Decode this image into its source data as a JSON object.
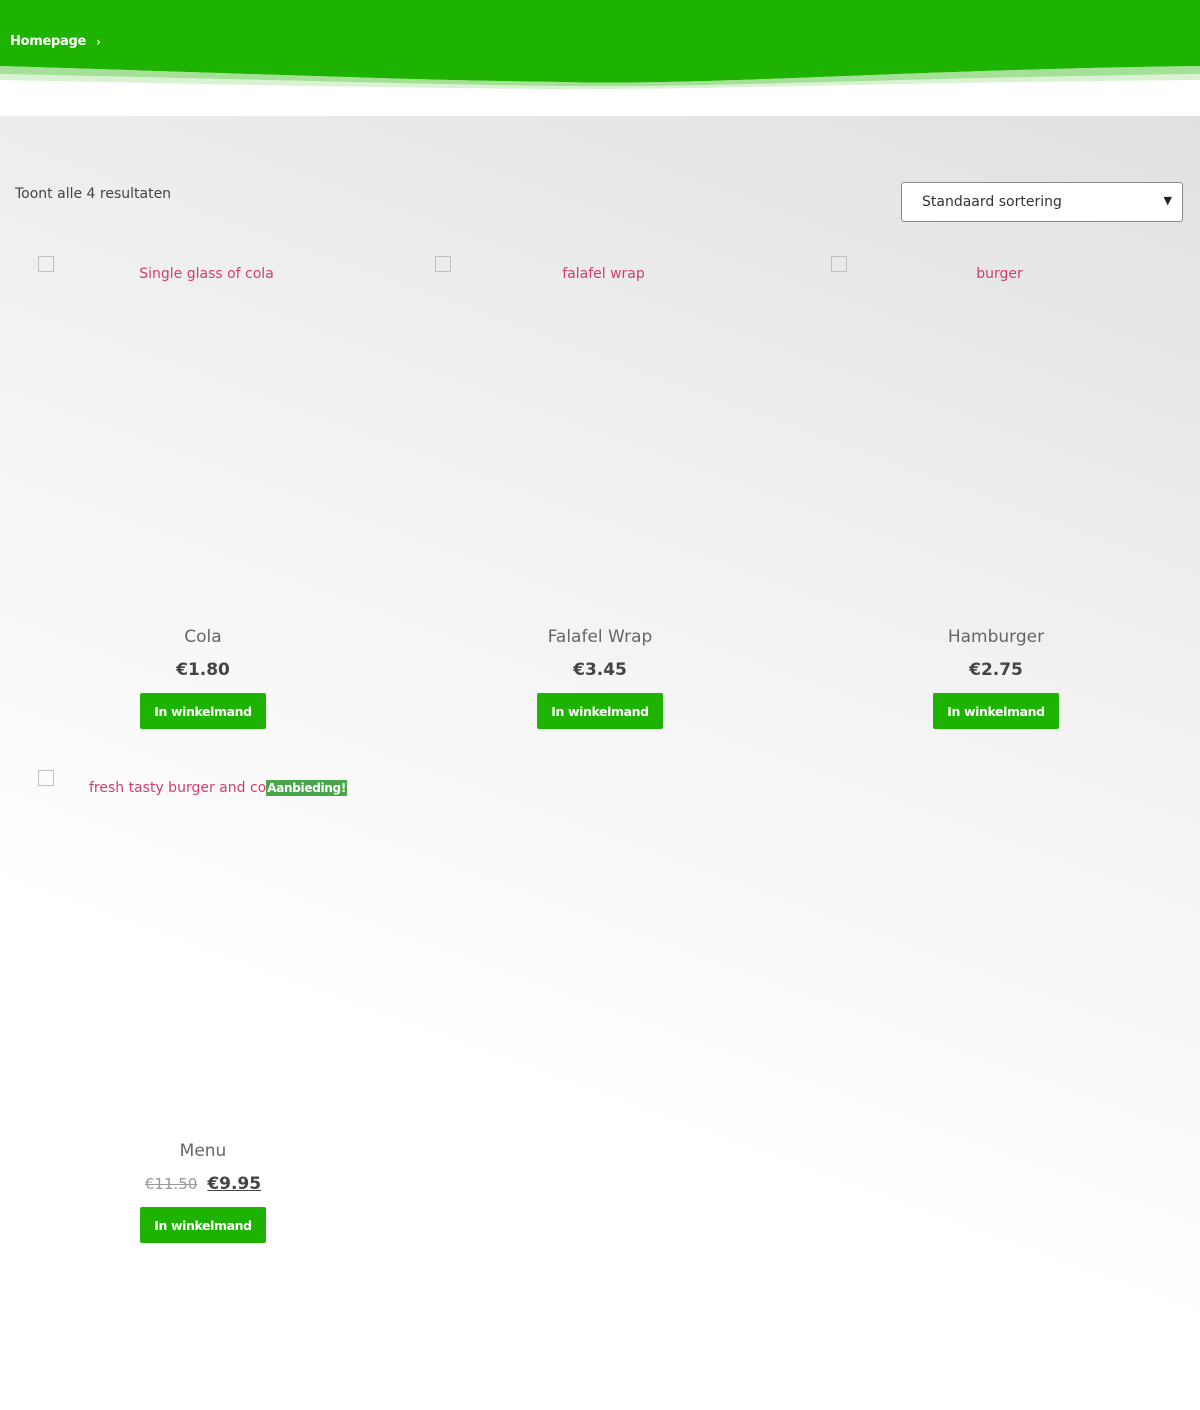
{
  "header": {
    "breadcrumb_home": "Homepage",
    "breadcrumb_separator": "›",
    "accent_color": "#1db300"
  },
  "shop": {
    "result_count": "Toont alle 4 resultaten",
    "sort_selected": "Standaard sortering"
  },
  "products": [
    {
      "image_alt": "Single glass of cola",
      "name": "Cola",
      "price": "€1.80",
      "button": "In winkelmand"
    },
    {
      "image_alt": "falafel wrap",
      "name": "Falafel Wrap",
      "price": "€3.45",
      "button": "In winkelmand"
    },
    {
      "image_alt": "burger",
      "name": "Hamburger",
      "price": "€2.75",
      "button": "In winkelmand"
    },
    {
      "image_alt": "fresh tasty burger and co",
      "sale_badge": "Aanbieding!",
      "name": "Menu",
      "old_price": "€11.50",
      "price": "€9.95",
      "button": "In winkelmand"
    }
  ]
}
